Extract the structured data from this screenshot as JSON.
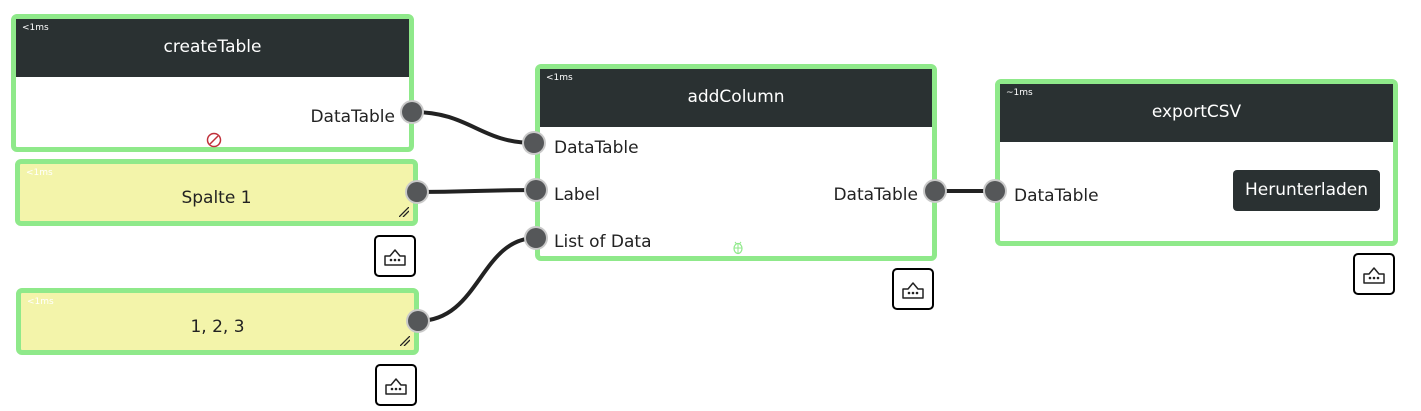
{
  "nodes": {
    "create_table": {
      "timing": "<1ms",
      "title": "createTable",
      "output_label": "DataTable"
    },
    "add_column": {
      "timing": "<1ms",
      "title": "addColumn",
      "inputs": [
        "DataTable",
        "Label",
        "List of Data"
      ],
      "output_label": "DataTable"
    },
    "export_csv": {
      "timing": "~1ms",
      "title": "exportCSV",
      "input_label": "DataTable",
      "button_label": "Herunterladen"
    }
  },
  "notes": [
    {
      "timing": "<1ms",
      "text": "Spalte 1"
    },
    {
      "timing": "<1ms",
      "text": "1, 2, 3"
    }
  ],
  "colors": {
    "node_border": "#8fe98a",
    "header_bg": "#2a3132",
    "note_bg": "#f3f4aa",
    "port": "#555759",
    "wire": "#222222"
  },
  "icons": {
    "disabled": "no-entry-icon",
    "debug": "bug-icon",
    "agent": "robot-icon"
  }
}
